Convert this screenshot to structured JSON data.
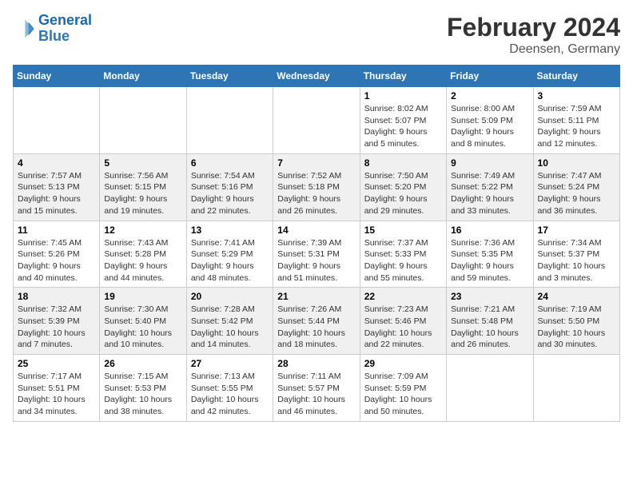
{
  "logo": {
    "line1": "General",
    "line2": "Blue"
  },
  "title": "February 2024",
  "subtitle": "Deensen, Germany",
  "days_of_week": [
    "Sunday",
    "Monday",
    "Tuesday",
    "Wednesday",
    "Thursday",
    "Friday",
    "Saturday"
  ],
  "weeks": [
    [
      {
        "day": "",
        "info": ""
      },
      {
        "day": "",
        "info": ""
      },
      {
        "day": "",
        "info": ""
      },
      {
        "day": "",
        "info": ""
      },
      {
        "day": "1",
        "info": "Sunrise: 8:02 AM\nSunset: 5:07 PM\nDaylight: 9 hours\nand 5 minutes."
      },
      {
        "day": "2",
        "info": "Sunrise: 8:00 AM\nSunset: 5:09 PM\nDaylight: 9 hours\nand 8 minutes."
      },
      {
        "day": "3",
        "info": "Sunrise: 7:59 AM\nSunset: 5:11 PM\nDaylight: 9 hours\nand 12 minutes."
      }
    ],
    [
      {
        "day": "4",
        "info": "Sunrise: 7:57 AM\nSunset: 5:13 PM\nDaylight: 9 hours\nand 15 minutes."
      },
      {
        "day": "5",
        "info": "Sunrise: 7:56 AM\nSunset: 5:15 PM\nDaylight: 9 hours\nand 19 minutes."
      },
      {
        "day": "6",
        "info": "Sunrise: 7:54 AM\nSunset: 5:16 PM\nDaylight: 9 hours\nand 22 minutes."
      },
      {
        "day": "7",
        "info": "Sunrise: 7:52 AM\nSunset: 5:18 PM\nDaylight: 9 hours\nand 26 minutes."
      },
      {
        "day": "8",
        "info": "Sunrise: 7:50 AM\nSunset: 5:20 PM\nDaylight: 9 hours\nand 29 minutes."
      },
      {
        "day": "9",
        "info": "Sunrise: 7:49 AM\nSunset: 5:22 PM\nDaylight: 9 hours\nand 33 minutes."
      },
      {
        "day": "10",
        "info": "Sunrise: 7:47 AM\nSunset: 5:24 PM\nDaylight: 9 hours\nand 36 minutes."
      }
    ],
    [
      {
        "day": "11",
        "info": "Sunrise: 7:45 AM\nSunset: 5:26 PM\nDaylight: 9 hours\nand 40 minutes."
      },
      {
        "day": "12",
        "info": "Sunrise: 7:43 AM\nSunset: 5:28 PM\nDaylight: 9 hours\nand 44 minutes."
      },
      {
        "day": "13",
        "info": "Sunrise: 7:41 AM\nSunset: 5:29 PM\nDaylight: 9 hours\nand 48 minutes."
      },
      {
        "day": "14",
        "info": "Sunrise: 7:39 AM\nSunset: 5:31 PM\nDaylight: 9 hours\nand 51 minutes."
      },
      {
        "day": "15",
        "info": "Sunrise: 7:37 AM\nSunset: 5:33 PM\nDaylight: 9 hours\nand 55 minutes."
      },
      {
        "day": "16",
        "info": "Sunrise: 7:36 AM\nSunset: 5:35 PM\nDaylight: 9 hours\nand 59 minutes."
      },
      {
        "day": "17",
        "info": "Sunrise: 7:34 AM\nSunset: 5:37 PM\nDaylight: 10 hours\nand 3 minutes."
      }
    ],
    [
      {
        "day": "18",
        "info": "Sunrise: 7:32 AM\nSunset: 5:39 PM\nDaylight: 10 hours\nand 7 minutes."
      },
      {
        "day": "19",
        "info": "Sunrise: 7:30 AM\nSunset: 5:40 PM\nDaylight: 10 hours\nand 10 minutes."
      },
      {
        "day": "20",
        "info": "Sunrise: 7:28 AM\nSunset: 5:42 PM\nDaylight: 10 hours\nand 14 minutes."
      },
      {
        "day": "21",
        "info": "Sunrise: 7:26 AM\nSunset: 5:44 PM\nDaylight: 10 hours\nand 18 minutes."
      },
      {
        "day": "22",
        "info": "Sunrise: 7:23 AM\nSunset: 5:46 PM\nDaylight: 10 hours\nand 22 minutes."
      },
      {
        "day": "23",
        "info": "Sunrise: 7:21 AM\nSunset: 5:48 PM\nDaylight: 10 hours\nand 26 minutes."
      },
      {
        "day": "24",
        "info": "Sunrise: 7:19 AM\nSunset: 5:50 PM\nDaylight: 10 hours\nand 30 minutes."
      }
    ],
    [
      {
        "day": "25",
        "info": "Sunrise: 7:17 AM\nSunset: 5:51 PM\nDaylight: 10 hours\nand 34 minutes."
      },
      {
        "day": "26",
        "info": "Sunrise: 7:15 AM\nSunset: 5:53 PM\nDaylight: 10 hours\nand 38 minutes."
      },
      {
        "day": "27",
        "info": "Sunrise: 7:13 AM\nSunset: 5:55 PM\nDaylight: 10 hours\nand 42 minutes."
      },
      {
        "day": "28",
        "info": "Sunrise: 7:11 AM\nSunset: 5:57 PM\nDaylight: 10 hours\nand 46 minutes."
      },
      {
        "day": "29",
        "info": "Sunrise: 7:09 AM\nSunset: 5:59 PM\nDaylight: 10 hours\nand 50 minutes."
      },
      {
        "day": "",
        "info": ""
      },
      {
        "day": "",
        "info": ""
      }
    ]
  ]
}
